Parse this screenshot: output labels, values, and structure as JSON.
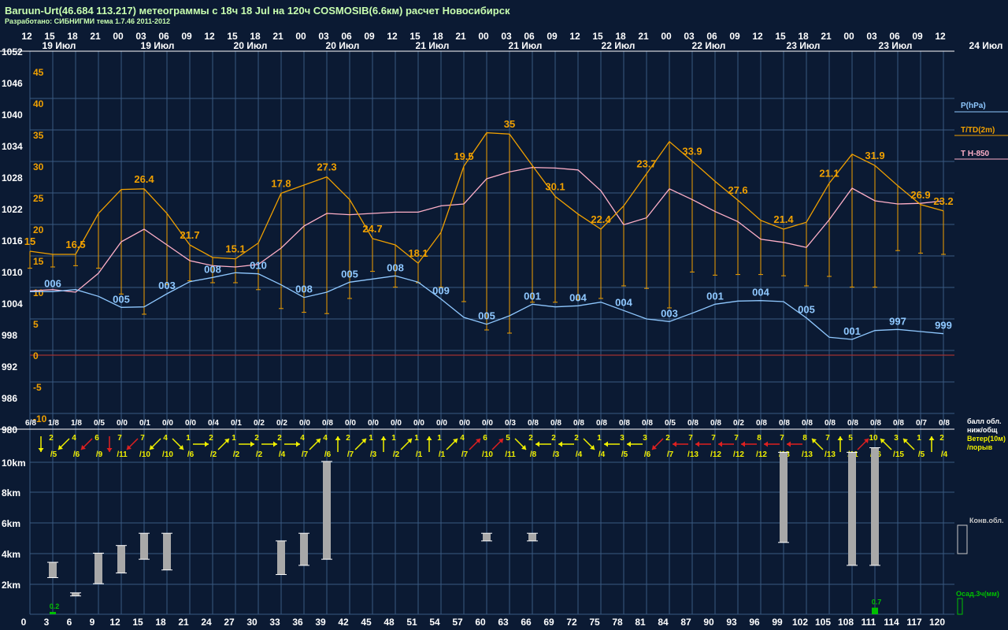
{
  "header": {
    "title": "Baruun-Urt(46.684 113.217) метеограммы с  18ч 18 Jul на 120ч COSMOSIB(6.6км) расчет Новосибирск",
    "subtitle": "Разработано: СИБНИГМИ тема 1.7.46 2011-2012"
  },
  "colors": {
    "background": "#0b1a33",
    "grid": "#3a5a82",
    "pressure": "#8fc8ff",
    "temperature": "#f0a000",
    "t850": "#ffb0c8",
    "wind_yellow": "#f0f000",
    "wind_red": "#e02020",
    "cloud_bar": "#a8a8a8",
    "precip": "#00c000",
    "zero_line": "#a03030"
  },
  "top_hour_labels": [
    "12",
    "15",
    "18",
    "21",
    "00",
    "03",
    "06",
    "09",
    "12",
    "15",
    "18",
    "21",
    "00",
    "03",
    "06",
    "09",
    "12",
    "15",
    "18",
    "21",
    "00",
    "03",
    "06",
    "09",
    "12",
    "15",
    "18",
    "21",
    "00",
    "03",
    "06",
    "09",
    "12",
    "15",
    "18",
    "21",
    "00",
    "03",
    "06",
    "09",
    "12"
  ],
  "day_labels": [
    "19 Июл",
    "19 Июл",
    "20 Июл",
    "20 Июл",
    "21 Июл",
    "21 Июл",
    "22 Июл",
    "22 Июл",
    "23 Июл",
    "23 Июл",
    "24 Июл"
  ],
  "bottom_hour_labels": [
    "0",
    "3",
    "6",
    "9",
    "12",
    "15",
    "18",
    "21",
    "24",
    "27",
    "30",
    "33",
    "36",
    "39",
    "42",
    "45",
    "48",
    "51",
    "54",
    "57",
    "60",
    "63",
    "66",
    "69",
    "72",
    "75",
    "78",
    "81",
    "84",
    "87",
    "90",
    "93",
    "96",
    "99",
    "102",
    "105",
    "108",
    "111",
    "114",
    "117",
    "120"
  ],
  "legend": {
    "pressure": "P(hPa)",
    "temperature": "T/TD(2m)",
    "t850": "T H-850",
    "cloud_row": "балл обл. ниж/общ",
    "wind_row": "Ветер(10м) /порыв",
    "conv_clouds": "Конв.обл.",
    "precip": "Осад.3ч(мм)"
  },
  "chart_data": [
    {
      "type": "line",
      "title": "",
      "x": [
        0,
        3,
        6,
        9,
        12,
        15,
        18,
        21,
        24,
        27,
        30,
        33,
        36,
        39,
        42,
        45,
        48,
        51,
        54,
        57,
        60,
        63,
        66,
        69,
        72,
        75,
        78,
        81,
        84,
        87,
        90,
        93,
        96,
        99,
        102,
        105,
        108,
        111,
        114,
        117,
        120
      ],
      "xlabel": "",
      "y_pressure_ticks": [
        "1052",
        "1046",
        "1040",
        "1034",
        "1028",
        "1022",
        "1016",
        "1010",
        "1004",
        "998",
        "992",
        "986",
        "980"
      ],
      "y_temperature_ticks": [
        "45",
        "40",
        "35",
        "30",
        "25",
        "20",
        "15",
        "10",
        "5",
        "0",
        "-5",
        "-10"
      ],
      "pressure_ylim": [
        980,
        1052
      ],
      "temperature_ylim": [
        -10,
        45
      ],
      "series": [
        {
          "name": "P(hPa)",
          "values": [
            1006.2,
            1006.2,
            1006.6,
            1005.3,
            1003.2,
            1003.3,
            1005.8,
            1008.1,
            1008.9,
            1009.8,
            1009.6,
            1007.5,
            1005.1,
            1006.1,
            1008.0,
            1008.6,
            1009.2,
            1008.0,
            1004.8,
            1001.3,
            1000.0,
            1001.6,
            1003.8,
            1003.3,
            1003.5,
            1004.2,
            1002.6,
            1001.0,
            1000.5,
            1002.1,
            1003.8,
            1004.4,
            1004.5,
            1004.3,
            1001.2,
            997.5,
            997.1,
            998.8,
            999.0,
            998.6,
            998.2
          ],
          "labels": [
            {
              "i": 1,
              "text": "006"
            },
            {
              "i": 4,
              "text": "005"
            },
            {
              "i": 6,
              "text": "003"
            },
            {
              "i": 8,
              "text": "008"
            },
            {
              "i": 10,
              "text": "010"
            },
            {
              "i": 12,
              "text": "008"
            },
            {
              "i": 14,
              "text": "005"
            },
            {
              "i": 16,
              "text": "008"
            },
            {
              "i": 18,
              "text": "009"
            },
            {
              "i": 20,
              "text": "005"
            },
            {
              "i": 22,
              "text": "001"
            },
            {
              "i": 24,
              "text": "004"
            },
            {
              "i": 26,
              "text": "004"
            },
            {
              "i": 28,
              "text": "003"
            },
            {
              "i": 30,
              "text": "001"
            },
            {
              "i": 32,
              "text": "004"
            },
            {
              "i": 34,
              "text": "005"
            },
            {
              "i": 36,
              "text": "001"
            },
            {
              "i": 38,
              "text": "997"
            },
            {
              "i": 40,
              "text": "999"
            }
          ]
        },
        {
          "name": "T/TD(2m)",
          "values": [
            16.5,
            16.0,
            16.0,
            22.5,
            26.3,
            26.4,
            22.5,
            17.5,
            15.5,
            15.3,
            17.8,
            25.7,
            27.0,
            28.3,
            24.7,
            18.5,
            17.5,
            14.6,
            19.5,
            30.0,
            35.3,
            35.1,
            30.1,
            25.2,
            22.4,
            20.0,
            23.7,
            28.8,
            33.9,
            30.8,
            27.6,
            24.6,
            21.4,
            20.0,
            21.1,
            27.3,
            31.9,
            30.1,
            26.9,
            23.9,
            22.9
          ],
          "dew_point": [
            13.8,
            14.0,
            14.2,
            13.8,
            9.7,
            6.5,
            11.2,
            11.8,
            11.5,
            11.5,
            10.4,
            7.4,
            6.8,
            6.6,
            9.0,
            13.3,
            10.8,
            11.5,
            10.8,
            8.5,
            4.0,
            3.5,
            8.4,
            8.4,
            8.8,
            9.0,
            11.0,
            10.6,
            7.5,
            13.2,
            12.7,
            12.8,
            12.8,
            12.6,
            11.0,
            12.5,
            10.8,
            10.8,
            16.6,
            16.2,
            16.0
          ],
          "labels": [
            {
              "i": 0,
              "text": "15"
            },
            {
              "i": 2,
              "text": "16.5"
            },
            {
              "i": 5,
              "text": "26.4"
            },
            {
              "i": 7,
              "text": "21.7"
            },
            {
              "i": 9,
              "text": "15.1"
            },
            {
              "i": 11,
              "text": "17.8"
            },
            {
              "i": 13,
              "text": "27.3"
            },
            {
              "i": 15,
              "text": "24.7"
            },
            {
              "i": 17,
              "text": "18.1"
            },
            {
              "i": 19,
              "text": "19.5"
            },
            {
              "i": 21,
              "text": "35"
            },
            {
              "i": 23,
              "text": "30.1"
            },
            {
              "i": 25,
              "text": "22.4"
            },
            {
              "i": 27,
              "text": "23.7"
            },
            {
              "i": 29,
              "text": "33.9"
            },
            {
              "i": 31,
              "text": "27.6"
            },
            {
              "i": 33,
              "text": "21.4"
            },
            {
              "i": 35,
              "text": "21.1"
            },
            {
              "i": 37,
              "text": "31.9"
            },
            {
              "i": 39,
              "text": "26.9"
            },
            {
              "i": 40,
              "text": "23.2"
            }
          ]
        },
        {
          "name": "T H-850",
          "values": [
            10.2,
            10.4,
            10.0,
            13.0,
            18.0,
            20.0,
            17.5,
            15.0,
            14.2,
            14.0,
            14.4,
            17.0,
            20.5,
            22.5,
            22.3,
            22.5,
            22.7,
            22.7,
            23.7,
            24.0,
            28.0,
            29.1,
            29.8,
            29.7,
            29.4,
            26.1,
            20.7,
            21.8,
            26.4,
            24.7,
            22.8,
            21.2,
            18.4,
            17.9,
            17.1,
            21.5,
            26.5,
            24.5,
            24.0,
            24.1,
            24.5
          ]
        }
      ],
      "cloud_cover": [
        "6/8",
        "1/8",
        "1/8",
        "0/5",
        "0/0",
        "0/1",
        "0/0",
        "0/0",
        "0/4",
        "0/1",
        "0/2",
        "0/2",
        "0/0",
        "0/8",
        "0/0",
        "0/0",
        "0/0",
        "0/0",
        "0/0",
        "0/0",
        "0/0",
        "0/3",
        "0/8",
        "0/8",
        "0/8",
        "0/8",
        "0/8",
        "0/8",
        "0/5",
        "0/8",
        "0/8",
        "0/2",
        "0/8",
        "0/8",
        "0/8",
        "0/8",
        "0/8",
        "0/8",
        "0/8",
        "0/7",
        "0/8"
      ],
      "wind": [
        {
          "dir": "s",
          "speed": "2",
          "gust": "/5",
          "color": "yellow"
        },
        {
          "dir": "sw",
          "speed": "4",
          "gust": "/6",
          "color": "yellow"
        },
        {
          "dir": "sw",
          "speed": "6",
          "gust": "/9",
          "color": "red"
        },
        {
          "dir": "s",
          "speed": "7",
          "gust": "/11",
          "color": "red"
        },
        {
          "dir": "sw",
          "speed": "7",
          "gust": "/10",
          "color": "red"
        },
        {
          "dir": "sw",
          "speed": "4",
          "gust": "/10",
          "color": "yellow"
        },
        {
          "dir": "se",
          "speed": "1",
          "gust": "/6",
          "color": "yellow"
        },
        {
          "dir": "e",
          "speed": "2",
          "gust": "/2",
          "color": "yellow"
        },
        {
          "dir": "ne",
          "speed": "1",
          "gust": "/2",
          "color": "yellow"
        },
        {
          "dir": "e",
          "speed": "2",
          "gust": "/2",
          "color": "yellow"
        },
        {
          "dir": "e",
          "speed": "2",
          "gust": "/4",
          "color": "yellow"
        },
        {
          "dir": "e",
          "speed": "4",
          "gust": "/7",
          "color": "yellow"
        },
        {
          "dir": "ne",
          "speed": "4",
          "gust": "/6",
          "color": "yellow"
        },
        {
          "dir": "n",
          "speed": "2",
          "gust": "/7",
          "color": "yellow"
        },
        {
          "dir": "ne",
          "speed": "1",
          "gust": "/3",
          "color": "yellow"
        },
        {
          "dir": "n",
          "speed": "1",
          "gust": "/2",
          "color": "yellow"
        },
        {
          "dir": "ne",
          "speed": "1",
          "gust": "/1",
          "color": "yellow"
        },
        {
          "dir": "n",
          "speed": "1",
          "gust": "/1",
          "color": "yellow"
        },
        {
          "dir": "ne",
          "speed": "4",
          "gust": "/7",
          "color": "yellow"
        },
        {
          "dir": "ne",
          "speed": "6",
          "gust": "/10",
          "color": "red"
        },
        {
          "dir": "ne",
          "speed": "5",
          "gust": "/11",
          "color": "red"
        },
        {
          "dir": "se",
          "speed": "2",
          "gust": "/8",
          "color": "yellow"
        },
        {
          "dir": "w",
          "speed": "2",
          "gust": "/3",
          "color": "yellow"
        },
        {
          "dir": "w",
          "speed": "2",
          "gust": "/4",
          "color": "yellow"
        },
        {
          "dir": "se",
          "speed": "1",
          "gust": "/4",
          "color": "yellow"
        },
        {
          "dir": "w",
          "speed": "3",
          "gust": "/5",
          "color": "yellow"
        },
        {
          "dir": "w",
          "speed": "3",
          "gust": "/6",
          "color": "yellow"
        },
        {
          "dir": "sw",
          "speed": "2",
          "gust": "/7",
          "color": "red"
        },
        {
          "dir": "w",
          "speed": "7",
          "gust": "/13",
          "color": "red"
        },
        {
          "dir": "w",
          "speed": "7",
          "gust": "/12",
          "color": "red"
        },
        {
          "dir": "w",
          "speed": "7",
          "gust": "/12",
          "color": "red"
        },
        {
          "dir": "w",
          "speed": "8",
          "gust": "/12",
          "color": "red"
        },
        {
          "dir": "w",
          "speed": "7",
          "gust": "/13",
          "color": "red"
        },
        {
          "dir": "w",
          "speed": "8",
          "gust": "/13",
          "color": "red"
        },
        {
          "dir": "nw",
          "speed": "7",
          "gust": "/13",
          "color": "yellow"
        },
        {
          "dir": "n",
          "speed": "5",
          "gust": "/11",
          "color": "yellow"
        },
        {
          "dir": "ne",
          "speed": "10",
          "gust": "/16",
          "color": "red"
        },
        {
          "dir": "nw",
          "speed": "3",
          "gust": "/15",
          "color": "yellow"
        },
        {
          "dir": "nw",
          "speed": "1",
          "gust": "/5",
          "color": "yellow"
        },
        {
          "dir": "n",
          "speed": "2",
          "gust": "/4",
          "color": "yellow"
        }
      ],
      "convective_clouds_km": {
        "y_ticks": [
          "10km",
          "8km",
          "6km",
          "4km",
          "2km"
        ],
        "ylim": [
          0,
          10.5
        ],
        "bars": [
          {
            "t": 3,
            "base": 2.4,
            "top": 3.4
          },
          {
            "t": 6,
            "base": 1.2,
            "top": 1.4
          },
          {
            "t": 9,
            "base": 2.0,
            "top": 4.0
          },
          {
            "t": 12,
            "base": 2.7,
            "top": 4.5
          },
          {
            "t": 15,
            "base": 3.6,
            "top": 5.3
          },
          {
            "t": 18,
            "base": 2.9,
            "top": 5.3
          },
          {
            "t": 33,
            "base": 2.6,
            "top": 4.8
          },
          {
            "t": 36,
            "base": 3.2,
            "top": 5.3
          },
          {
            "t": 39,
            "base": 3.6,
            "top": 10.0
          },
          {
            "t": 60,
            "base": 4.8,
            "top": 5.3
          },
          {
            "t": 66,
            "base": 4.8,
            "top": 5.3
          },
          {
            "t": 99,
            "base": 4.7,
            "top": 10.6
          },
          {
            "t": 108,
            "base": 3.2,
            "top": 10.6
          },
          {
            "t": 111,
            "base": 3.2,
            "top": 10.9
          }
        ]
      },
      "precipitation_mm": [
        {
          "t": 3,
          "value": 0.2,
          "label": "0.2"
        },
        {
          "t": 111,
          "value": 0.7,
          "label": "0.7"
        }
      ]
    }
  ]
}
